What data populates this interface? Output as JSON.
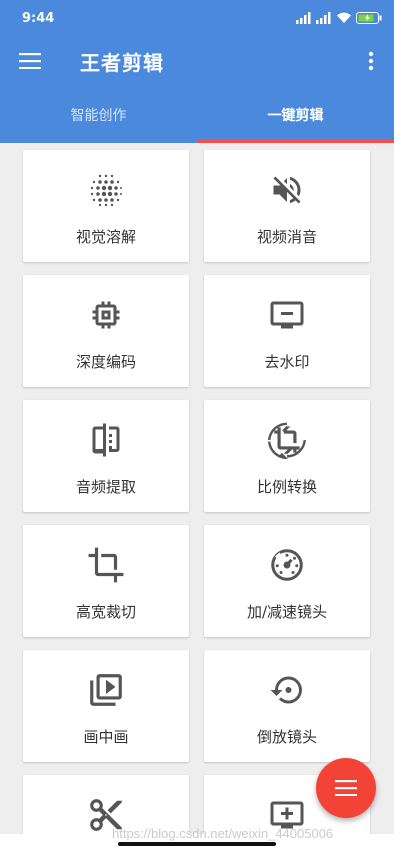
{
  "status_bar": {
    "time": "9:44"
  },
  "app": {
    "title": "王者剪辑"
  },
  "tabs": [
    {
      "label": "智能创作",
      "active": false
    },
    {
      "label": "一键剪辑",
      "active": true
    }
  ],
  "tools": [
    {
      "label": "视觉溶解",
      "icon": "dotted-circle-icon"
    },
    {
      "label": "视频消音",
      "icon": "volume-off-icon"
    },
    {
      "label": "深度编码",
      "icon": "chip-icon"
    },
    {
      "label": "去水印",
      "icon": "monitor-minus-icon"
    },
    {
      "label": "音频提取",
      "icon": "compare-icon"
    },
    {
      "label": "比例转换",
      "icon": "crop-rotate-icon"
    },
    {
      "label": "高宽裁切",
      "icon": "crop-icon"
    },
    {
      "label": "加/减速镜头",
      "icon": "speed-icon"
    },
    {
      "label": "画中画",
      "icon": "video-library-icon"
    },
    {
      "label": "倒放镜头",
      "icon": "rewind-icon"
    },
    {
      "label": "",
      "icon": "scissors-icon"
    },
    {
      "label": "",
      "icon": "monitor-plus-icon"
    }
  ],
  "watermark": "https://blog.csdn.net/weixin_44005006",
  "colors": {
    "primary": "#4a89dc",
    "accent": "#f24336",
    "tab_indicator": "#ff4a4a",
    "icon": "#555555"
  }
}
